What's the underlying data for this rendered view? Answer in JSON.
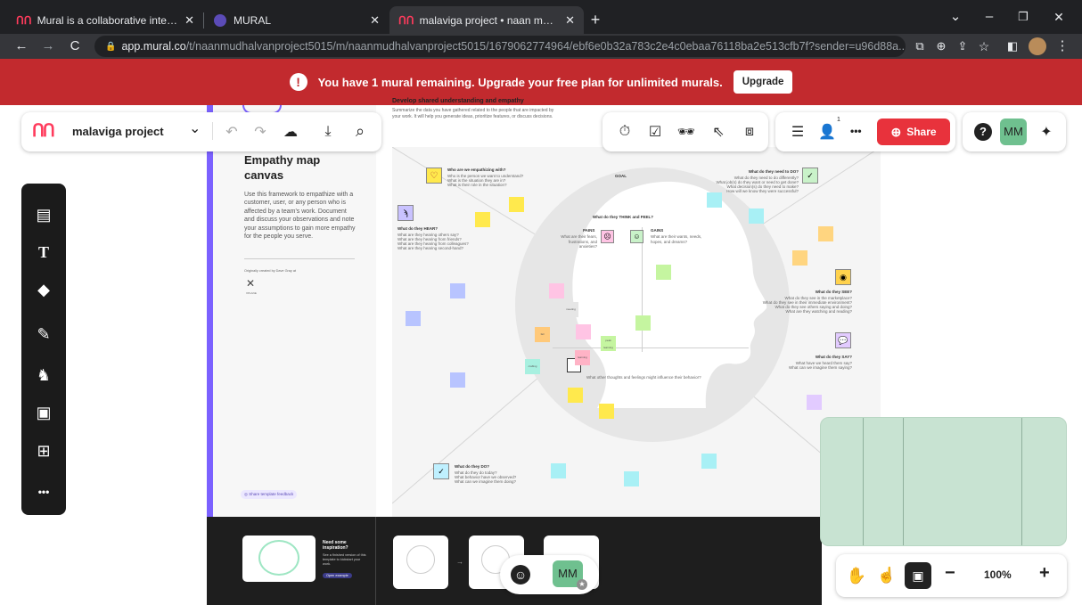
{
  "browser": {
    "tabs": [
      {
        "title": "Mural is a collaborative intelligen",
        "icon": "mural-logo-icon"
      },
      {
        "title": "MURAL",
        "icon": "mural-circle-icon"
      },
      {
        "title": "malaviga project • naan mudhalv",
        "icon": "mural-logo-icon"
      }
    ],
    "new_tab": "+",
    "window_controls": {
      "dropdown": "⌄",
      "minimize": "–",
      "restore": "❐",
      "close": "✕"
    },
    "url_host": "app.mural.co",
    "url_path": "/t/naanmudhalvanproject5015/m/naanmudhalvanproject5015/1679062774964/ebf6e0b32a783c2e4c0ebaa76118ba2e513cfb7f?sender=u96d88a..."
  },
  "banner": {
    "message": "You have 1 mural remaining. Upgrade your free plan for unlimited murals.",
    "button": "Upgrade",
    "color": "#c22a2e"
  },
  "topbar": {
    "project_name": "malaviga project",
    "dropdown": "⌄",
    "collaborator_badge": "1",
    "more": "•••",
    "share": "Share",
    "help": "?",
    "avatar": "MM",
    "share_color": "#e8323c"
  },
  "sidebar": {
    "items": [
      "sticky-note",
      "text",
      "shapes",
      "pen",
      "icons",
      "image",
      "templates",
      "more"
    ],
    "more_label": "•••"
  },
  "template": {
    "heading": "Develop shared understanding and empathy",
    "subtext": "Summarize the data you have gathered related to the people that are impacted by your work. It will help you generate ideas, prioritize features, or discuss decisions.",
    "title": "Empathy map canvas",
    "description": "Use this framework to empathize with a customer, user, or any person who is affected by a team's work. Document and discuss your observations and note your assumptions to gain more empathy for the people you serve.",
    "credit": "Originally created by Dave Gray at",
    "credit_logo": "XPLANE",
    "feedback": "Share template feedback",
    "goal": "GOAL",
    "who_title": "Who are we empathizing with?",
    "who_lines": [
      "Who is the person we want to understand?",
      "What is the situation they are in?",
      "What is their role in the situation?"
    ],
    "hear_title": "What do they HEAR?",
    "hear_lines": [
      "What are they hearing others say?",
      "What are they hearing from friends?",
      "What are they hearing from colleagues?",
      "What are they hearing second-hand?"
    ],
    "think_title": "What do they THINK and FEEL?",
    "pains": "PAINS",
    "pains_text": "What are their fears, frustrations, and anxieties?",
    "gains": "GAINS",
    "gains_text": "What are their wants, needs, hopes, and dreams?",
    "do_need_title": "What do they need to DO?",
    "do_need_lines": [
      "What do they need to do differently?",
      "What job(s) do they want or need to get done?",
      "What decision(s) do they need to make?",
      "How will we know they were successful?"
    ],
    "see_title": "What do they SEE?",
    "see_lines": [
      "What do they see in the marketplace?",
      "What do they see in their immediate environment?",
      "What do they see others saying and doing?",
      "What are they watching and reading?"
    ],
    "say_title": "What do they SAY?",
    "say_lines": [
      "What have we heard them say?",
      "What can we imagine them saying?"
    ],
    "do_title": "What do they DO?",
    "do_lines": [
      "What do they do today?",
      "What behavior have we observed?",
      "What can we imagine them doing?"
    ],
    "other": "What other thoughts and feelings might influence their behavior?",
    "sticky_labels": [
      "meeting",
      "crafting",
      "peak learning",
      "learning",
      "fail"
    ],
    "inspire_title": "Need some inspiration?",
    "inspire_text": "See a finished version of this template to kickstart your work.",
    "inspire_button": "Open example"
  },
  "bottom": {
    "avatar": "MM",
    "zoom": "100%",
    "zoom_minus": "−",
    "zoom_plus": "+"
  }
}
